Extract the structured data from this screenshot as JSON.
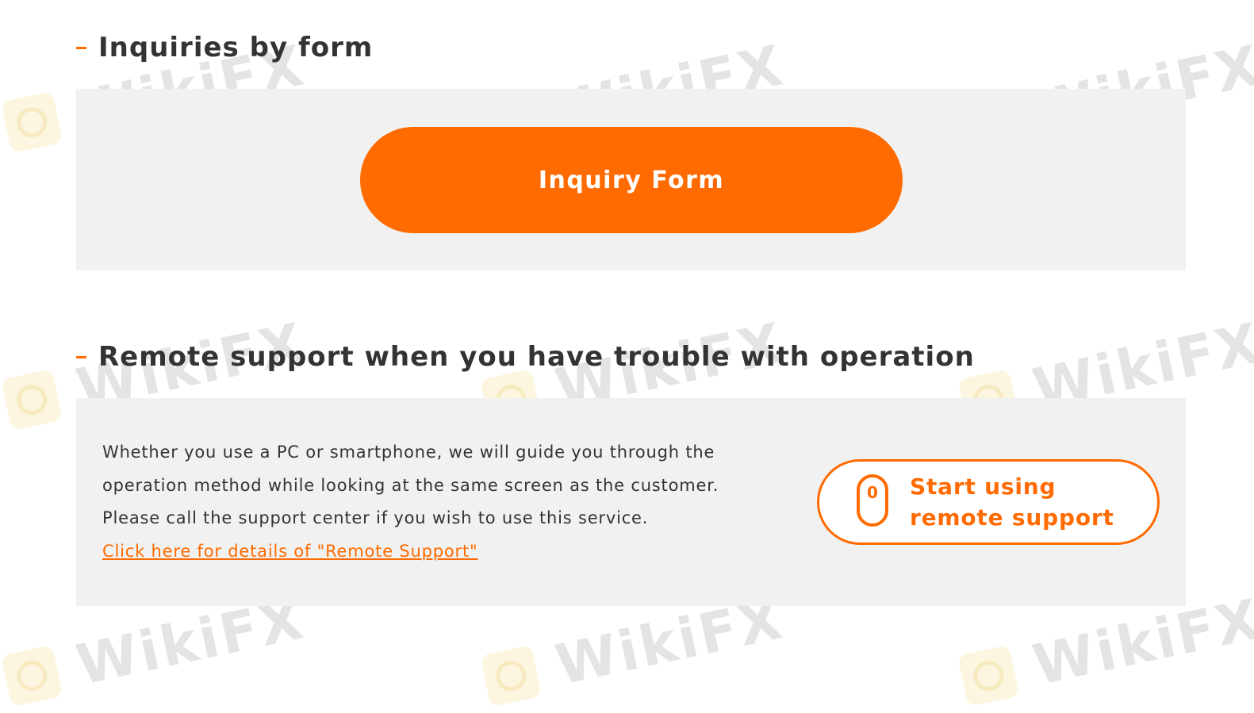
{
  "sections": {
    "form": {
      "heading": "Inquiries by form",
      "button_label": "Inquiry Form"
    },
    "remote": {
      "heading": "Remote support when you have trouble with operation",
      "description_lines": [
        "Whether you use a PC or smartphone, we will guide you through the",
        "operation method while looking at the same screen as the customer.",
        "Please call the support center if you wish to use this service."
      ],
      "details_link": "Click here for details of \"Remote Support\"",
      "button_label_lines": [
        "Start using",
        "remote support"
      ],
      "button_icon": "mouse-icon",
      "button_icon_text": "0"
    }
  },
  "watermark": {
    "text": "WikiFX"
  },
  "colors": {
    "accent": "#ff6b00",
    "panel_background": "#f1f1f1",
    "text": "#333333"
  }
}
